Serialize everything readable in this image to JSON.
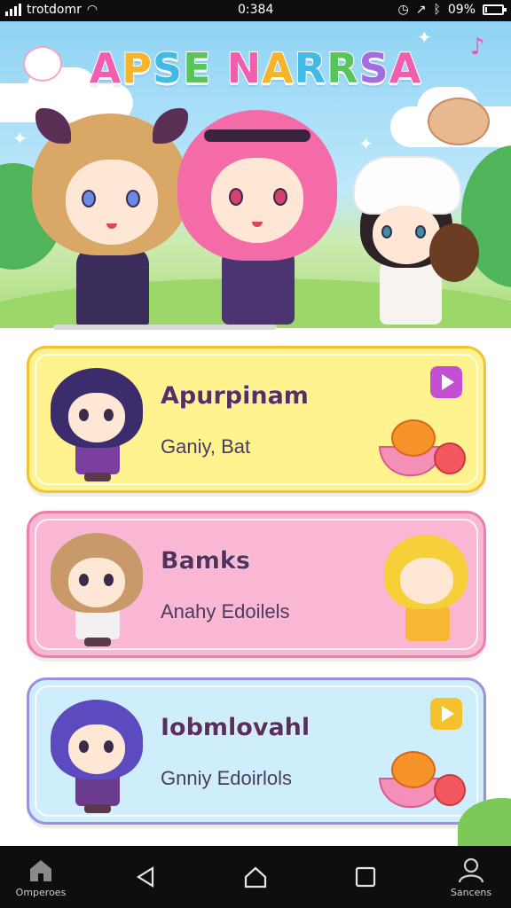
{
  "status_bar": {
    "carrier": "trotdomr",
    "time": "0:384",
    "battery_text": "09%",
    "battery_level": 0.09
  },
  "banner": {
    "title": "APSE NARRSA"
  },
  "cards": [
    {
      "name": "Apurpinam",
      "subtitle": "Ganiy, Bat",
      "bg": "#fff38f",
      "border": "#f0c330",
      "badge_color": "#c54fd3",
      "avatar_hair": "#3b2c6b",
      "avatar_outfit": "#7b3fa0"
    },
    {
      "name": "Bamks",
      "subtitle": "Anahy Edoilels",
      "bg": "#f9b7d3",
      "border": "#ec7fae",
      "badge_color": "",
      "avatar_hair": "#c89a6a",
      "avatar_outfit": "#f4f0f2"
    },
    {
      "name": "Iobmlovahl",
      "subtitle": "Gnniy Edoirlols",
      "bg": "#cfeefb",
      "border": "#9b8fe0",
      "badge_color": "#f5c22d",
      "avatar_hair": "#5b4bbf",
      "avatar_outfit": "#6b3b8f"
    }
  ],
  "nav": {
    "home_label": "Omperoes",
    "profile_label": "Sancens"
  },
  "icons": {
    "nav_home": "home-icon",
    "nav_back": "back-triangle-icon",
    "nav_circle": "home-circle-icon",
    "nav_recents": "recents-square-icon",
    "nav_profile": "person-icon",
    "status_wifi": "wifi-icon",
    "status_alarm": "alarm-icon",
    "status_bluetooth": "bluetooth-icon"
  }
}
